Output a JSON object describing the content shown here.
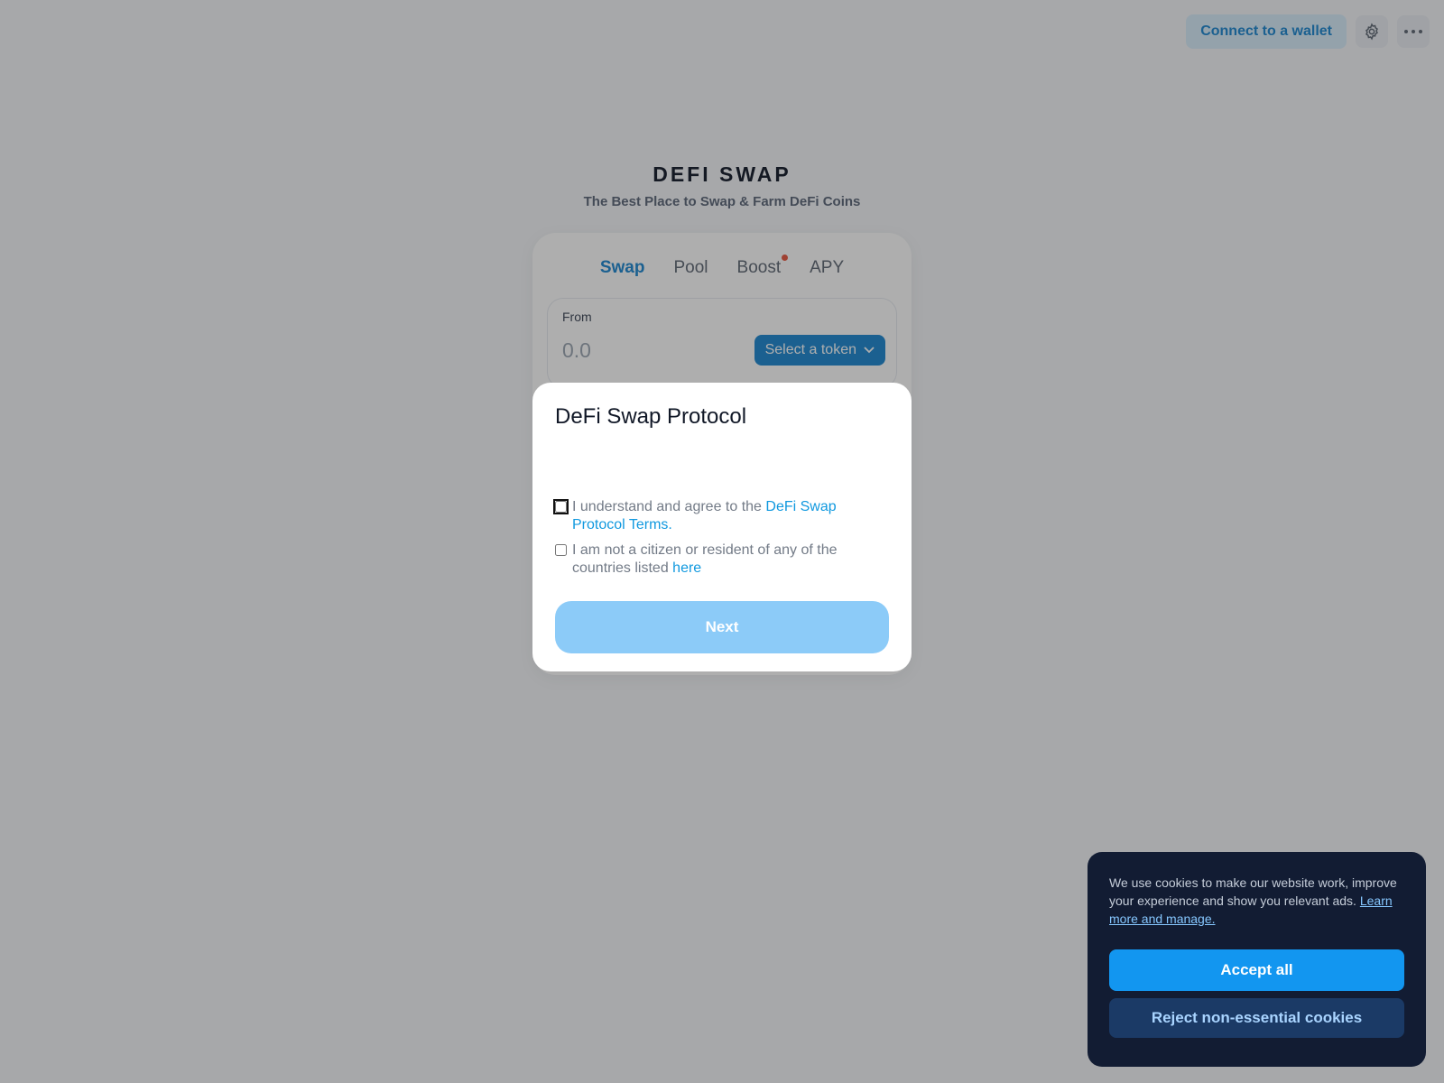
{
  "header": {
    "connect_wallet": "Connect to a wallet",
    "icons": {
      "settings": "gear-icon",
      "more": "more-horizontal-icon"
    }
  },
  "brand": {
    "title": "DEFI SWAP",
    "subtitle": "The Best Place to Swap & Farm DeFi Coins"
  },
  "swap": {
    "tabs": [
      "Swap",
      "Pool",
      "Boost",
      "APY"
    ],
    "active_tab": "Swap",
    "from_label": "From",
    "amount_placeholder": "0.0",
    "token_button": "Select a token"
  },
  "modal": {
    "title": "DeFi Swap Protocol",
    "agree_prefix": "I understand and agree to the",
    "agree_link": "DeFi Swap Protocol Terms.",
    "citizen_prefix": "I am not a citizen or resident of any of the countries listed",
    "citizen_link": "here",
    "next_label": "Next"
  },
  "cookie": {
    "text": "We use cookies to make our website work, improve your experience and show you relevant ads.",
    "link": "Learn more and manage.",
    "accept_label": "Accept all",
    "reject_label": "Reject non-essential cookies"
  },
  "colors": {
    "primary": "#1a86d0",
    "link": "#1199df",
    "cookie_bg": "#121c33",
    "next_disabled": "#8ccbf8"
  }
}
